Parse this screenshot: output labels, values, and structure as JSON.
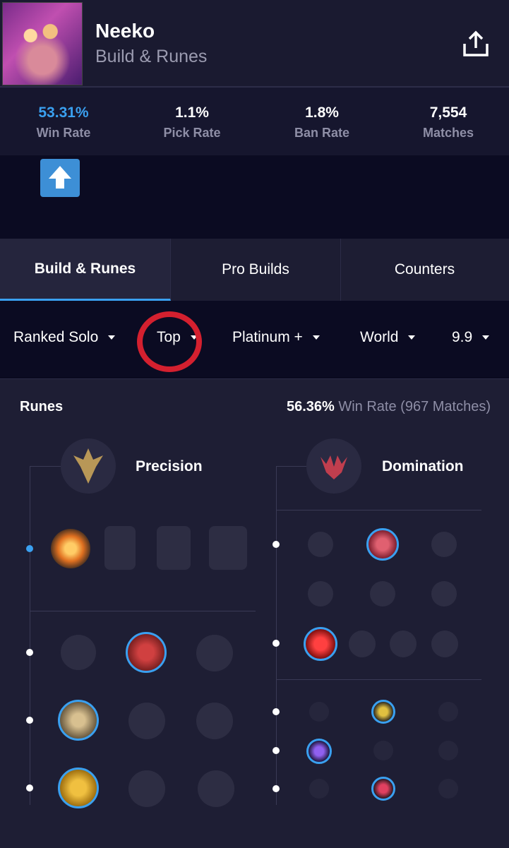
{
  "header": {
    "champion_name": "Neeko",
    "subtitle": "Build & Runes",
    "share_icon": "share-icon"
  },
  "stats": [
    {
      "value": "53.31%",
      "label": "Win Rate"
    },
    {
      "value": "1.1%",
      "label": "Pick Rate"
    },
    {
      "value": "1.8%",
      "label": "Ban Rate"
    },
    {
      "value": "7,554",
      "label": "Matches"
    }
  ],
  "tabs": [
    {
      "label": "Build & Runes"
    },
    {
      "label": "Pro Builds"
    },
    {
      "label": "Counters"
    }
  ],
  "filters": [
    {
      "label": "Ranked Solo"
    },
    {
      "label": "Top"
    },
    {
      "label": "Platinum +"
    },
    {
      "label": "World"
    },
    {
      "label": "9.9"
    }
  ],
  "runes": {
    "title": "Runes",
    "win_rate": "56.36%",
    "win_rate_suffix": "Win Rate (967 Matches)",
    "primary_tree": "Precision",
    "secondary_tree": "Domination"
  },
  "colors": {
    "accent": "#3aa0f0",
    "highlight_circle": "#d4202f",
    "precision": "#c8a35a",
    "domination": "#d04050"
  }
}
